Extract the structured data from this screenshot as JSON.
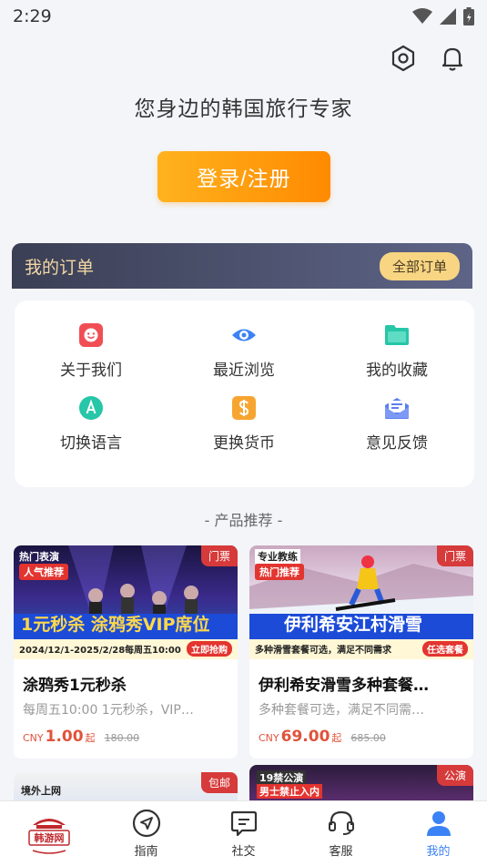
{
  "status": {
    "time": "2:29"
  },
  "header": {
    "slogan": "您身边的韩国旅行专家",
    "login_label": "登录/注册"
  },
  "orders": {
    "title": "我的订单",
    "all_label": "全部订单"
  },
  "menu": [
    {
      "label": "关于我们",
      "icon": "smile-icon",
      "color": "#f04e54"
    },
    {
      "label": "最近浏览",
      "icon": "eye-icon",
      "color": "#3b82f6"
    },
    {
      "label": "我的收藏",
      "icon": "folder-icon",
      "color": "#26c6a8"
    },
    {
      "label": "切换语言",
      "icon": "language-icon",
      "color": "#26c6a8"
    },
    {
      "label": "更换货币",
      "icon": "currency-icon",
      "color": "#f7a531"
    },
    {
      "label": "意见反馈",
      "icon": "feedback-icon",
      "color": "#5b7ff0"
    }
  ],
  "recommend": {
    "title": "- 产品推荐 -",
    "products": [
      {
        "tag": "门票",
        "title": "涂鸦秀1元秒杀",
        "desc": "每周五10:00 1元秒杀，VIP…",
        "currency": "CNY",
        "price": "1.00",
        "suffix": "起",
        "original": "180.00",
        "banner": {
          "top_label": "热门表演",
          "hot_label": "人气推荐",
          "headline": "1元秒杀 涂鸦秀VIP席位",
          "date": "2024/12/1-2025/2/28",
          "schedule": "每周五10:00",
          "cta": "立即抢购"
        }
      },
      {
        "tag": "门票",
        "title": "伊利希安滑雪多种套餐…",
        "desc": "多种套餐可选，满足不同需…",
        "currency": "CNY",
        "price": "69.00",
        "suffix": "起",
        "original": "685.00",
        "banner": {
          "top_label": "专业教练",
          "hot_label": "热门推荐",
          "headline": "伊利希安江村滑雪",
          "sub": "多种滑雪套餐可选，满足不同需求",
          "cta": "任选套餐"
        }
      }
    ],
    "more": [
      {
        "tag": "包邮",
        "label": "境外上网"
      },
      {
        "tag": "公演",
        "label": "19禁公演",
        "sub": "男士禁止入内"
      }
    ]
  },
  "tabbar": [
    {
      "label": "",
      "icon": "logo-icon",
      "logo_text": "韩游网"
    },
    {
      "label": "指南",
      "icon": "navigation-icon"
    },
    {
      "label": "社交",
      "icon": "chat-icon"
    },
    {
      "label": "客服",
      "icon": "headset-icon"
    },
    {
      "label": "我的",
      "icon": "person-icon",
      "active": true
    }
  ],
  "colors": {
    "accent": "#ff8a00",
    "tab_active": "#3b82f6",
    "price": "#e0533b",
    "tag": "#d63a3a"
  }
}
